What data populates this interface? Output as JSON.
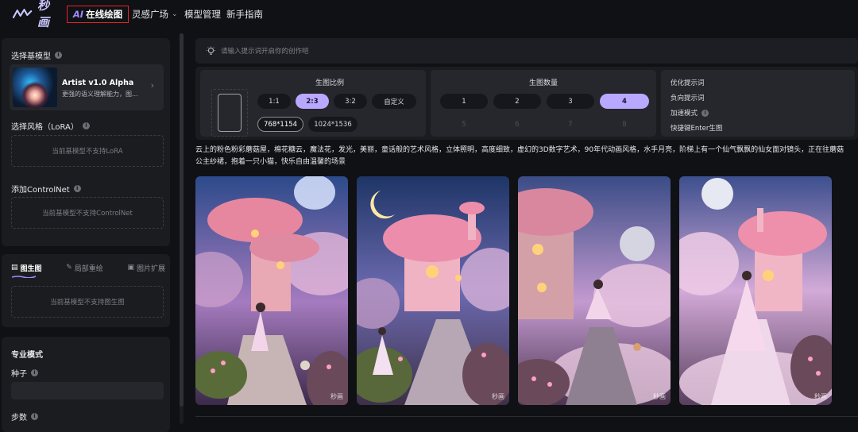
{
  "header": {
    "logo_text": "秒画",
    "nav": [
      {
        "label": "AI 在线绘图",
        "ai": "AI",
        "rest": "在线绘图"
      },
      {
        "label": "灵感广场"
      },
      {
        "label": "模型管理"
      },
      {
        "label": "新手指南"
      }
    ]
  },
  "sidebar": {
    "base_model_label": "选择基模型",
    "model_name": "Artist v1.0 Alpha",
    "model_desc": "更强的语义理解能力，图...",
    "lora_label": "选择风格（LoRA）",
    "lora_empty": "当前基模型不支持LoRA",
    "controlnet_label": "添加ControlNet",
    "controlnet_empty": "当前基模型不支持ControlNet",
    "tabs": [
      "图生图",
      "局部重绘",
      "图片扩展"
    ],
    "img2img_empty": "当前基模型不支持图生图",
    "pro_mode_label": "专业模式",
    "seed_label": "种子",
    "steps_label": "步数"
  },
  "prompt": {
    "placeholder": "请输入提示词开启你的创作吧"
  },
  "settings": {
    "ratio_title": "生图比例",
    "ratios": [
      "1:1",
      "2:3",
      "3:2",
      "自定义"
    ],
    "selected_ratio": "2:3",
    "sizes": [
      "768*1154",
      "1024*1536"
    ],
    "selected_size": "768*1154",
    "count_title": "生图数量",
    "counts": [
      "1",
      "2",
      "3",
      "4"
    ],
    "counts_disabled": [
      "5",
      "6",
      "7",
      "8"
    ],
    "selected_count": "4",
    "options": [
      "优化提示词",
      "负向提示词",
      "加速模式",
      "快捷键Enter生图"
    ]
  },
  "result": {
    "prompt_line1": "云上的粉色粉彩蘑菇屋，棉花糖云，魔法花，发光，美丽，童话般的艺术风格，立体照明，高度细致，虚幻的3D数字艺术，90年代动画风格，水手月亮，阶梯上有一个仙气飘飘的仙女面对镜头，正在往蘑菇",
    "prompt_line2": "公主纱裙，抱着一只小猫，快乐自由温馨的场景",
    "watermark": "秒画"
  },
  "colors": {
    "accent": "#b9a8ff",
    "highlight_border": "#e0242c"
  }
}
